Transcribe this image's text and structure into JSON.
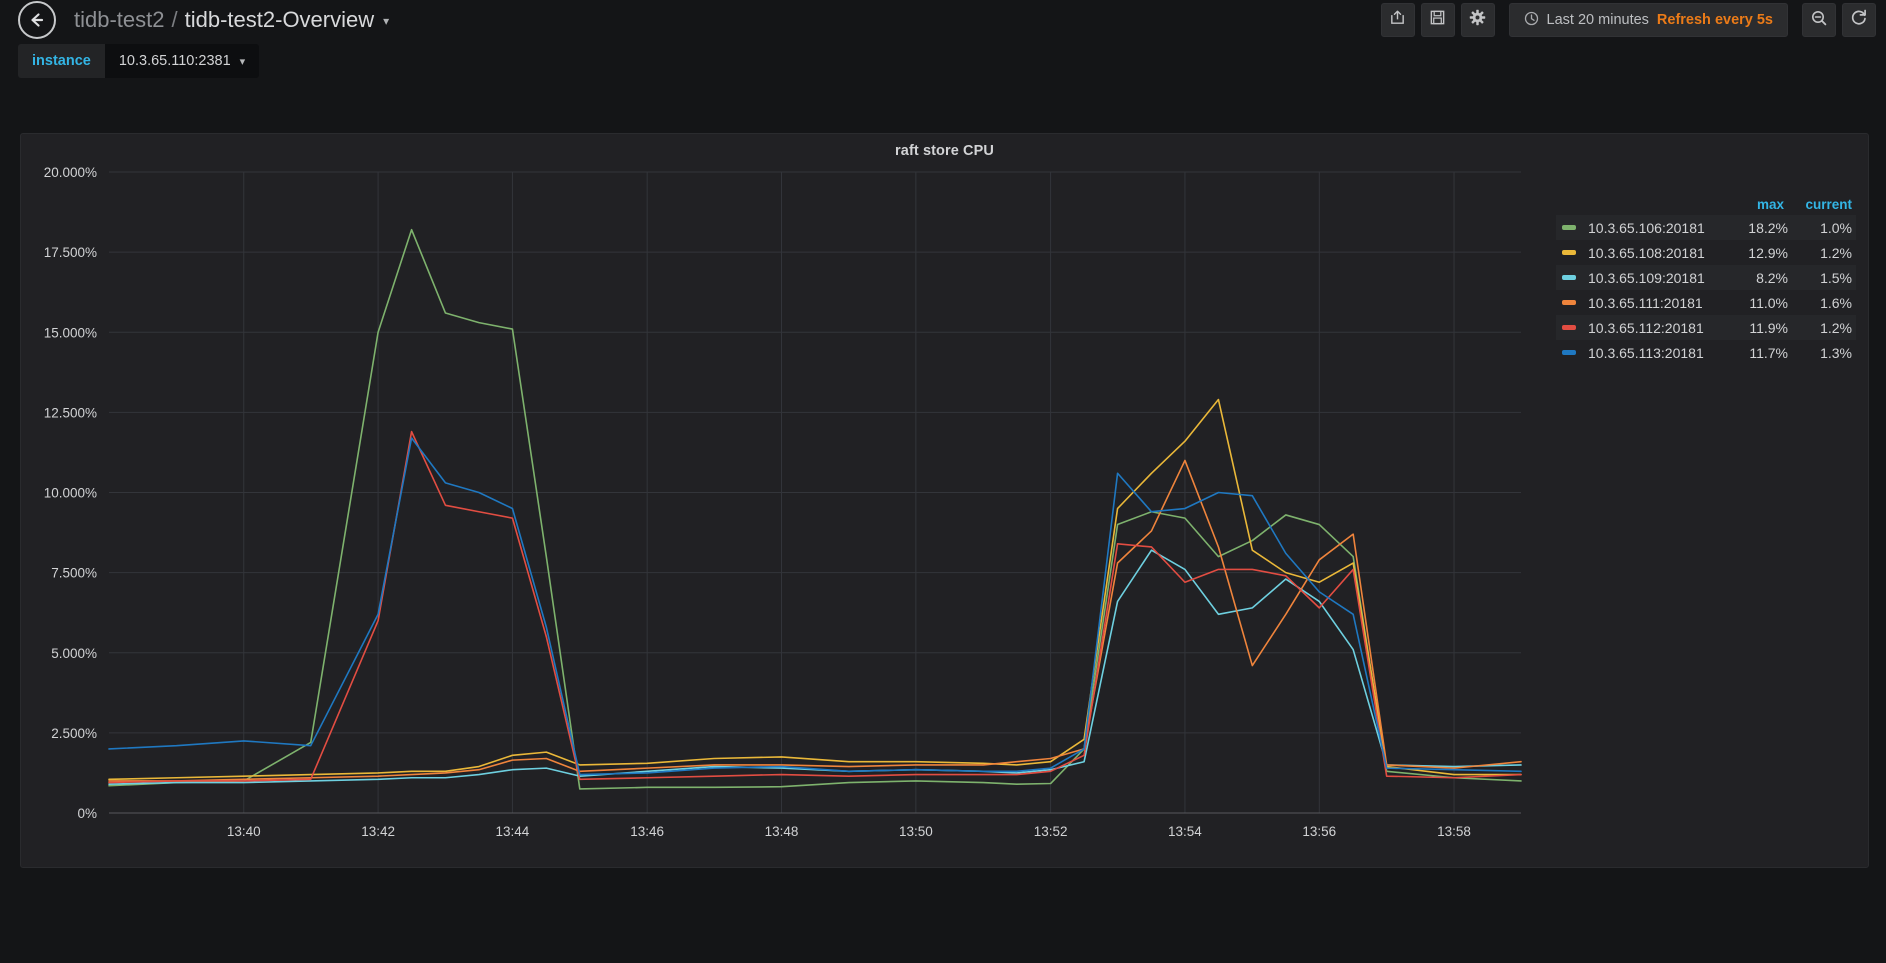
{
  "navbar": {
    "back_icon": "arrow-left-icon",
    "breadcrumb": {
      "folder": "tidb-test2",
      "separator": "/",
      "dashboard": "tidb-test2-Overview",
      "caret": "▾"
    },
    "actions": [
      {
        "name": "share-dashboard-button",
        "icon": "share-icon"
      },
      {
        "name": "save-dashboard-button",
        "icon": "save-icon"
      },
      {
        "name": "dashboard-settings-button",
        "icon": "gear-icon"
      }
    ],
    "timepicker": {
      "clock_icon": "clock-icon",
      "range": "Last 20 minutes",
      "refresh": "Refresh every 5s"
    },
    "zoom_out": {
      "name": "zoom-out-button",
      "icon": "magnifier-minus-icon"
    },
    "refresh": {
      "name": "refresh-button",
      "icon": "refresh-icon"
    }
  },
  "variables": [
    {
      "label": "instance",
      "value": "10.3.65.110:2381",
      "caret": "▾"
    }
  ],
  "panel": {
    "title": "raft store CPU"
  },
  "legend": {
    "columns": [
      "max",
      "current"
    ],
    "rows": [
      {
        "name": "10.3.65.106:20181",
        "color": "#7eb26d",
        "max": "18.2%",
        "current": "1.0%"
      },
      {
        "name": "10.3.65.108:20181",
        "color": "#eab839",
        "max": "12.9%",
        "current": "1.2%"
      },
      {
        "name": "10.3.65.109:20181",
        "color": "#6ed0e0",
        "max": "8.2%",
        "current": "1.5%"
      },
      {
        "name": "10.3.65.111:20181",
        "color": "#ef843c",
        "max": "11.0%",
        "current": "1.6%"
      },
      {
        "name": "10.3.65.112:20181",
        "color": "#e24d42",
        "max": "11.9%",
        "current": "1.2%"
      },
      {
        "name": "10.3.65.113:20181",
        "color": "#1f78c1",
        "max": "11.7%",
        "current": "1.3%"
      }
    ]
  },
  "chart_data": {
    "type": "line",
    "title": "raft store CPU",
    "xlabel": "",
    "ylabel": "",
    "unit": "percent",
    "grid": true,
    "legend_position": "right",
    "ylim": [
      0,
      20
    ],
    "yticks": [
      0,
      2.5,
      5,
      7.5,
      10,
      12.5,
      15,
      17.5,
      20
    ],
    "ytick_labels": [
      "0%",
      "2.500%",
      "5.000%",
      "7.500%",
      "10.000%",
      "12.500%",
      "15.000%",
      "17.500%",
      "20.000%"
    ],
    "xlim": [
      13.6333,
      13.9833
    ],
    "xticks": [
      13.6667,
      13.7,
      13.7333,
      13.7667,
      13.8,
      13.8333,
      13.8667,
      13.9,
      13.9333,
      13.9667
    ],
    "xtick_labels": [
      "13:40",
      "13:42",
      "13:44",
      "13:46",
      "13:48",
      "13:50",
      "13:52",
      "13:54",
      "13:56",
      "13:58"
    ],
    "x": [
      13.6333,
      13.65,
      13.6667,
      13.6833,
      13.7,
      13.7083,
      13.7167,
      13.725,
      13.7333,
      13.7417,
      13.75,
      13.7667,
      13.7833,
      13.8,
      13.8167,
      13.8333,
      13.85,
      13.8583,
      13.8667,
      13.875,
      13.8833,
      13.8917,
      13.9,
      13.9083,
      13.9167,
      13.925,
      13.9333,
      13.9417,
      13.95,
      13.9667,
      13.9833
    ],
    "series": [
      {
        "name": "10.3.65.106:20181",
        "color": "#7eb26d",
        "max": 18.2,
        "current": 1.0,
        "values": [
          0.85,
          0.95,
          1.0,
          2.2,
          15.0,
          18.2,
          15.6,
          15.3,
          15.1,
          8.0,
          0.75,
          0.8,
          0.8,
          0.82,
          0.95,
          1.0,
          0.95,
          0.9,
          0.92,
          2.0,
          9.0,
          9.4,
          9.2,
          8.0,
          8.5,
          9.3,
          9.0,
          8.0,
          1.3,
          1.1,
          1.0
        ]
      },
      {
        "name": "10.3.65.108:20181",
        "color": "#eab839",
        "max": 12.9,
        "current": 1.2,
        "values": [
          1.05,
          1.1,
          1.15,
          1.2,
          1.25,
          1.3,
          1.3,
          1.45,
          1.8,
          1.9,
          1.5,
          1.55,
          1.7,
          1.75,
          1.6,
          1.6,
          1.55,
          1.5,
          1.6,
          2.3,
          9.5,
          10.6,
          11.6,
          12.9,
          8.2,
          7.5,
          7.2,
          7.8,
          1.45,
          1.2,
          1.2
        ]
      },
      {
        "name": "10.3.65.109:20181",
        "color": "#6ed0e0",
        "max": 8.2,
        "current": 1.5,
        "values": [
          0.9,
          0.95,
          0.95,
          1.0,
          1.05,
          1.1,
          1.1,
          1.2,
          1.35,
          1.4,
          1.15,
          1.3,
          1.45,
          1.4,
          1.3,
          1.35,
          1.3,
          1.25,
          1.35,
          1.6,
          6.6,
          8.2,
          7.6,
          6.2,
          6.4,
          7.3,
          6.6,
          5.1,
          1.5,
          1.45,
          1.5
        ]
      },
      {
        "name": "10.3.65.111:20181",
        "color": "#ef843c",
        "max": 11.0,
        "current": 1.6,
        "values": [
          1.0,
          1.0,
          1.05,
          1.1,
          1.15,
          1.2,
          1.25,
          1.35,
          1.65,
          1.7,
          1.3,
          1.4,
          1.5,
          1.5,
          1.45,
          1.5,
          1.5,
          1.6,
          1.7,
          2.0,
          7.8,
          8.8,
          11.0,
          8.3,
          4.6,
          6.2,
          7.9,
          8.7,
          1.5,
          1.4,
          1.6
        ]
      },
      {
        "name": "10.3.65.112:20181",
        "color": "#e24d42",
        "max": 11.9,
        "current": 1.2,
        "values": [
          0.95,
          1.0,
          1.0,
          1.05,
          6.0,
          11.9,
          9.6,
          9.4,
          9.2,
          5.5,
          1.05,
          1.1,
          1.15,
          1.2,
          1.15,
          1.2,
          1.2,
          1.2,
          1.3,
          1.8,
          8.4,
          8.3,
          7.2,
          7.6,
          7.6,
          7.4,
          6.4,
          7.6,
          1.15,
          1.1,
          1.2
        ]
      },
      {
        "name": "10.3.65.113:20181",
        "color": "#1f78c1",
        "max": 11.7,
        "current": 1.3,
        "values": [
          2.0,
          2.1,
          2.25,
          2.1,
          6.2,
          11.7,
          10.3,
          10.0,
          9.5,
          5.8,
          1.2,
          1.25,
          1.4,
          1.45,
          1.3,
          1.35,
          1.3,
          1.3,
          1.4,
          2.0,
          10.6,
          9.4,
          9.5,
          10.0,
          9.9,
          8.1,
          6.9,
          6.2,
          1.4,
          1.35,
          1.3
        ]
      }
    ]
  }
}
